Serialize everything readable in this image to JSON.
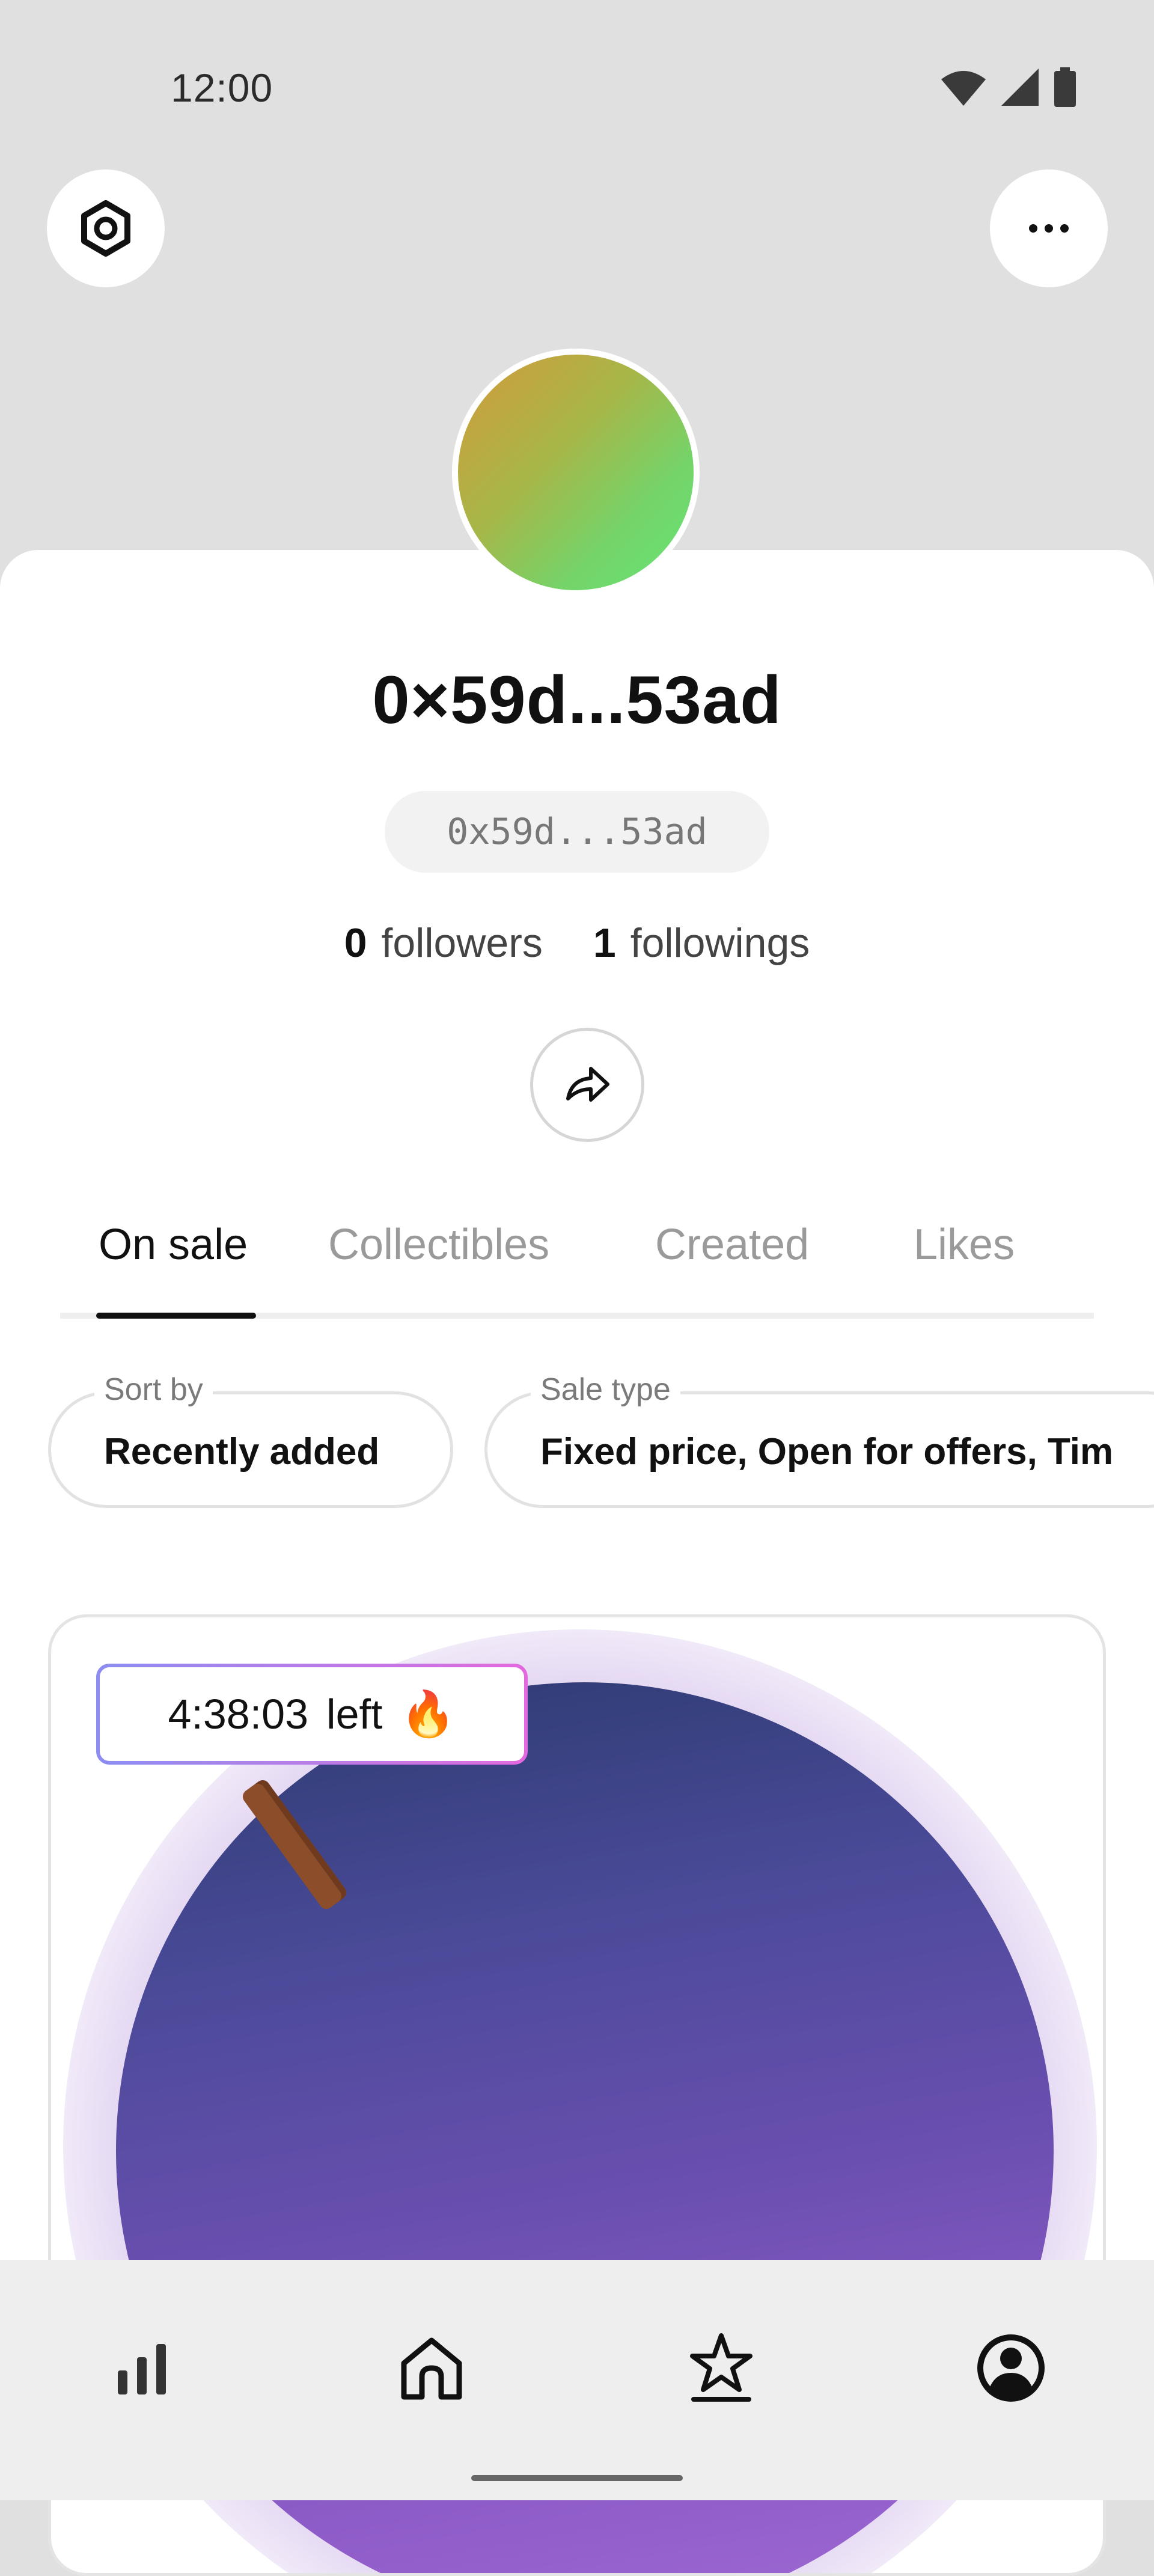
{
  "status_bar": {
    "time": "12:00",
    "icons": [
      "wifi-icon",
      "signal-icon",
      "battery-icon"
    ]
  },
  "top_bar": {
    "left_icon": "settings-icon",
    "right_icon": "more-icon"
  },
  "profile": {
    "display_name": "0×59d...53ad",
    "address": "0x59d...53ad",
    "followers_count": "0",
    "followers_label": "followers",
    "followings_count": "1",
    "followings_label": "followings",
    "avatar_colors": [
      "#d49a3a",
      "#66e575"
    ]
  },
  "tabs": [
    {
      "label": "On sale",
      "active": true
    },
    {
      "label": "Collectibles",
      "active": false
    },
    {
      "label": "Created",
      "active": false
    },
    {
      "label": "Likes",
      "active": false
    }
  ],
  "filters": {
    "sort": {
      "label": "Sort by",
      "value": "Recently added"
    },
    "sale_type": {
      "label": "Sale type",
      "value": "Fixed price, Open for offers, Tim"
    }
  },
  "card": {
    "timer": "4:38:03",
    "timer_suffix": "left",
    "timer_emoji": "🔥",
    "art_colors": [
      "#2b3a6e",
      "#a16ad4"
    ]
  },
  "bottom_nav": [
    {
      "icon": "stats-icon"
    },
    {
      "icon": "home-icon"
    },
    {
      "icon": "star-icon"
    },
    {
      "icon": "profile-icon",
      "active": true
    }
  ]
}
